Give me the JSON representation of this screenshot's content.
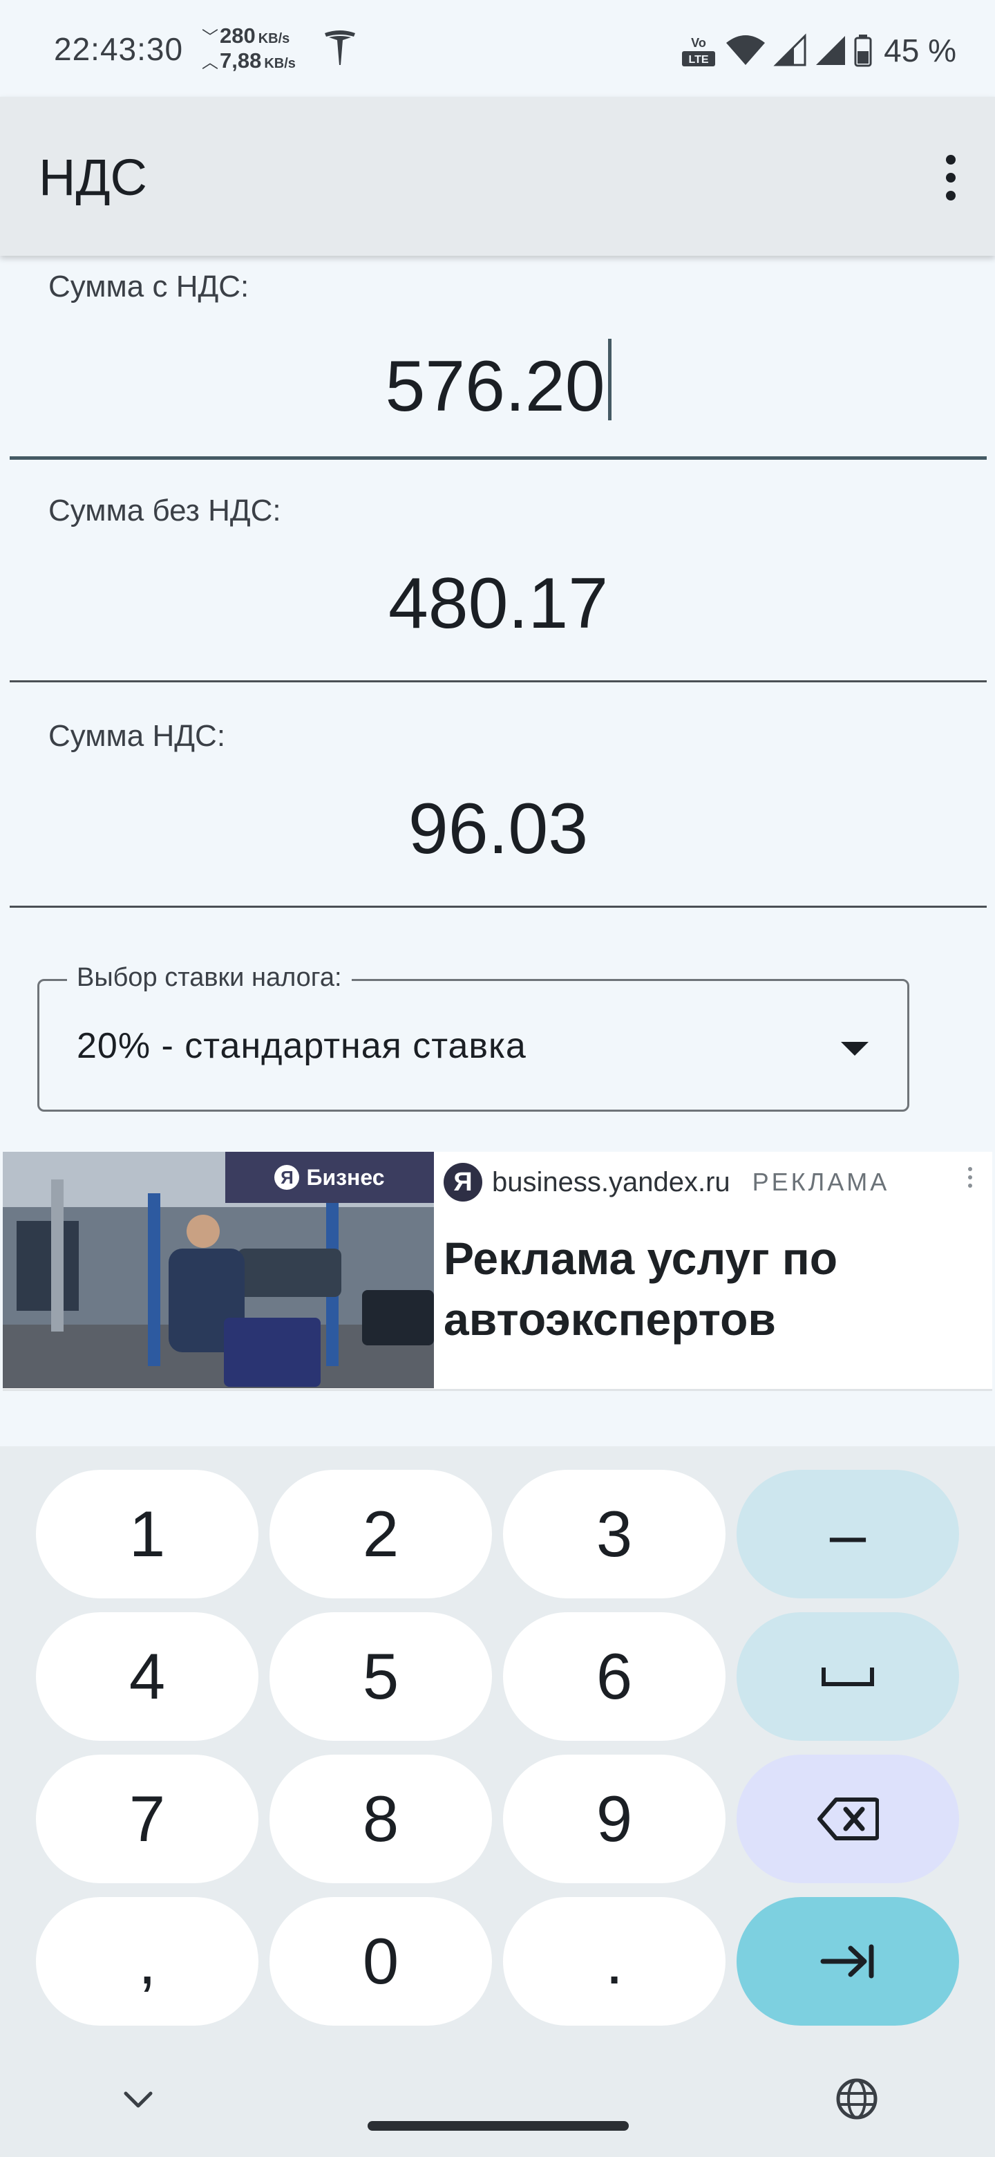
{
  "status_bar": {
    "time": "22:43:30",
    "net_down": "280",
    "net_up": "7,88",
    "net_unit": "KB/s",
    "battery": "45 %",
    "icons": [
      "tesla-icon",
      "volte-icon",
      "wifi-icon",
      "signal-icon",
      "signal-icon",
      "battery-icon"
    ]
  },
  "app_bar": {
    "title": "НДС",
    "menu_icon": "more-vert-icon"
  },
  "fields": {
    "gross": {
      "label": "Сумма с НДС:",
      "value": "576.20"
    },
    "net": {
      "label": "Сумма без НДС:",
      "value": "480.17"
    },
    "vat": {
      "label": "Сумма НДС:",
      "value": "96.03"
    }
  },
  "rate_select": {
    "label": "Выбор ставки налога:",
    "value": "20% - стандартная ставка"
  },
  "ad": {
    "badge": "Бизнес",
    "badge_logo": "Я",
    "logo": "Я",
    "domain": "business.yandex.ru",
    "tag": "РЕКЛАМА",
    "title": "Реклама услуг по автоэкспертов"
  },
  "keyboard": {
    "keys": {
      "k1": "1",
      "k2": "2",
      "k3": "3",
      "minus": "–",
      "k4": "4",
      "k5": "5",
      "k6": "6",
      "k7": "7",
      "k8": "8",
      "k9": "9",
      "comma": ",",
      "k0": "0",
      "dot": "."
    },
    "icons": [
      "space-icon",
      "backspace-icon",
      "next-icon",
      "chevron-down-icon",
      "globe-icon"
    ]
  },
  "colors": {
    "background": "#f2f7fb",
    "app_bar": "#e6eaed",
    "key": "#ffffff",
    "key_function": "#cde6ee",
    "key_delete": "#dde1fb",
    "key_enter": "#7dd0e0"
  }
}
